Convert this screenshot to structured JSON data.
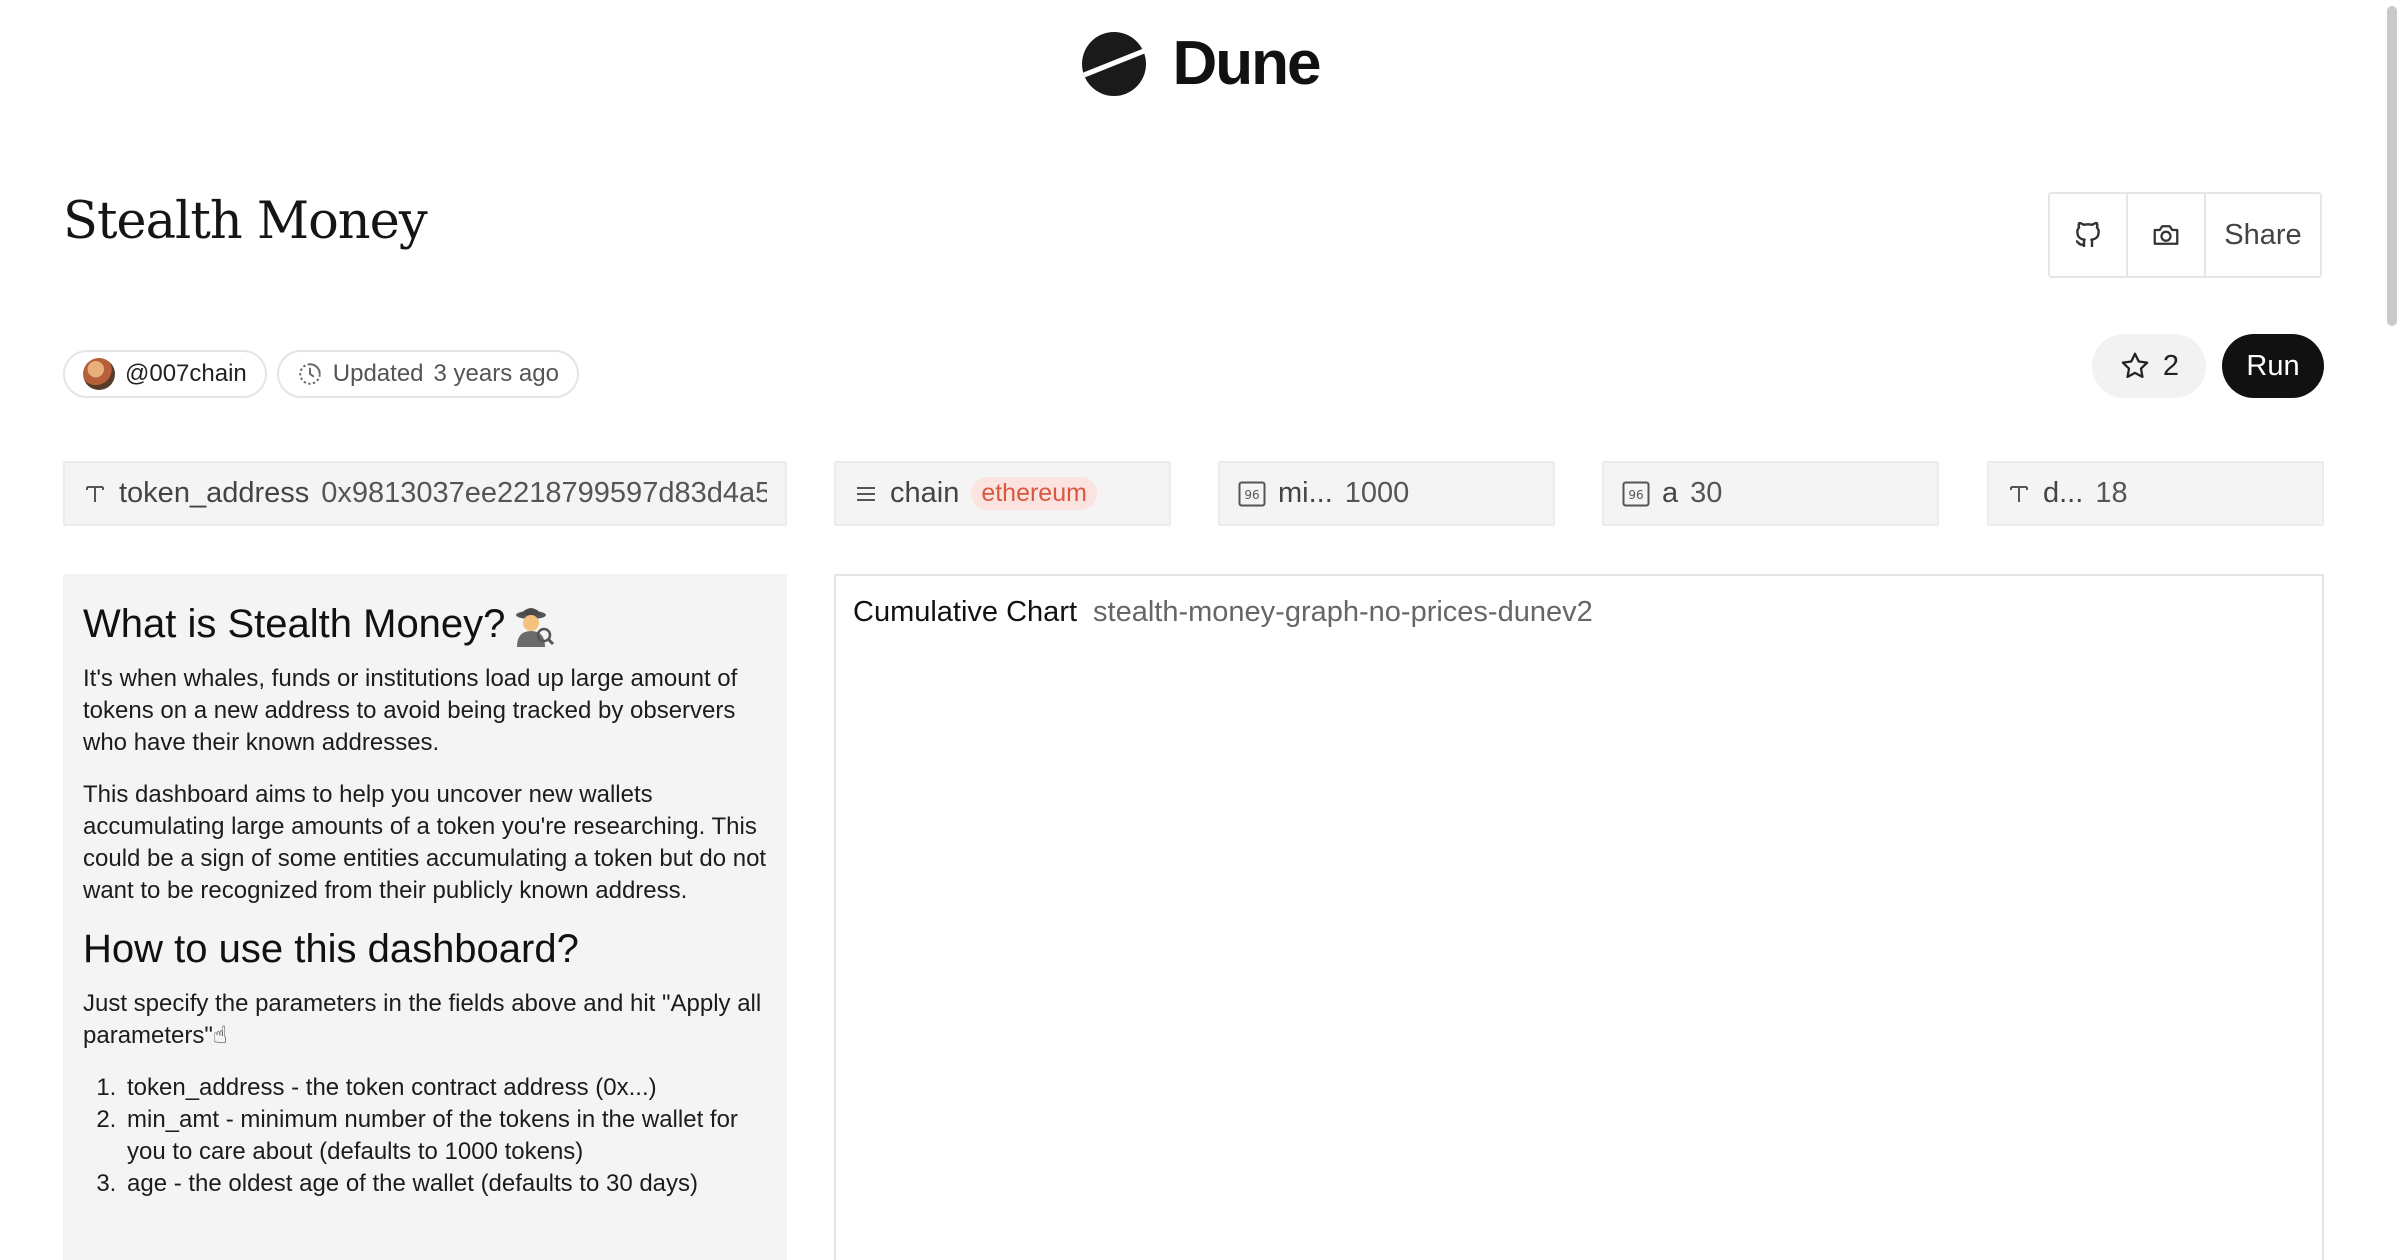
{
  "brand": {
    "name": "Dune"
  },
  "dashboard": {
    "title": "Stealth Money",
    "share_label": "Share",
    "author": "@007chain",
    "updated_label": "Updated",
    "updated_time": "3 years ago",
    "star_count": "2",
    "run_label": "Run"
  },
  "params": [
    {
      "type_icon": "text-icon",
      "name": "token_address",
      "value": "0x9813037ee2218799597d83d4a5"
    },
    {
      "type_icon": "list-icon",
      "name": "chain",
      "value": "ethereum"
    },
    {
      "type_icon": "number-icon",
      "name": "mi...",
      "value": "1000"
    },
    {
      "type_icon": "number-icon",
      "name": "a",
      "value": "30"
    },
    {
      "type_icon": "text-icon",
      "name": "d...",
      "value": "18"
    }
  ],
  "text_widget": {
    "heading1": "What is Stealth Money?",
    "para1": "It's when whales, funds or institutions load up large amount of tokens on a new address to avoid being tracked by observers who have their known addresses.",
    "para2": "This dashboard aims to help you uncover new wallets accumulating large amounts of a token you're researching. This could be a sign of some entities accumulating a token but do not want to be recognized from their publicly known address.",
    "heading2": "How to use this dashboard?",
    "para3": "Just specify the parameters in the fields above and hit \"Apply all parameters\"☝",
    "list": [
      "token_address - the token contract address (0x...)",
      "min_amt - minimum number of the tokens in the wallet for you to care about (defaults to 1000 tokens)",
      "age - the oldest age of the wallet (defaults to 30 days)"
    ]
  },
  "chart_widget": {
    "kind": "Cumulative Chart",
    "query_name": "stealth-money-graph-no-prices-dunev2"
  }
}
